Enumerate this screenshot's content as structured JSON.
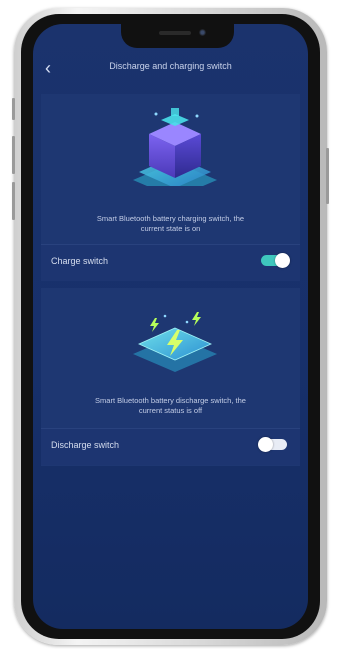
{
  "header": {
    "title": "Discharge and charging switch"
  },
  "charge": {
    "description_line1": "Smart Bluetooth battery charging switch, the",
    "description_line2": "current state is on",
    "label": "Charge switch",
    "state": "on"
  },
  "discharge": {
    "description_line1": "Smart Bluetooth battery discharge switch, the",
    "description_line2": "current status is off",
    "label": "Discharge switch",
    "state": "off"
  },
  "colors": {
    "screen": "#17306b",
    "toggle_on": "#3fc7bd",
    "toggle_off": "#e8ecf5"
  }
}
